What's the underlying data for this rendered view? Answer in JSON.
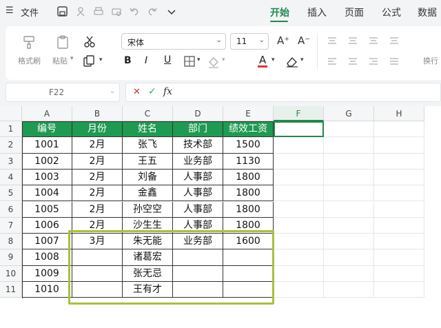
{
  "menu": {
    "hamburger_glyph": "☰",
    "file_label": "文件",
    "tabs": [
      "开始",
      "插入",
      "页面",
      "公式",
      "数据"
    ],
    "active_tab": "开始"
  },
  "ribbon": {
    "format_painter_label": "格式刷",
    "paste_label": "粘贴",
    "font_name": "宋体",
    "font_size": "11",
    "bold_glyph": "B",
    "italic_glyph": "I",
    "underline_glyph": "U",
    "font_color_glyph": "A",
    "increase_font_glyph": "A⁺",
    "decrease_font_glyph": "A⁻",
    "wrap_label": "换行",
    "accent_color": "#1e8a4a",
    "font_color": "#e0322f"
  },
  "formula_bar": {
    "cell_ref": "F22",
    "cancel_glyph": "✕",
    "confirm_glyph": "✓",
    "fx_glyph": "fx"
  },
  "sheet": {
    "columns": [
      "A",
      "B",
      "C",
      "D",
      "E",
      "F",
      "G",
      "H"
    ],
    "rows": [
      "1",
      "2",
      "3",
      "4",
      "5",
      "6",
      "7",
      "8",
      "9",
      "10",
      "11"
    ],
    "header_row": [
      "编号",
      "月份",
      "姓名",
      "部门",
      "绩效工资"
    ],
    "data": [
      [
        "1001",
        "2月",
        "张飞",
        "技术部",
        "1500"
      ],
      [
        "1002",
        "2月",
        "王五",
        "业务部",
        "1130"
      ],
      [
        "1003",
        "2月",
        "刘备",
        "人事部",
        "1800"
      ],
      [
        "1004",
        "2月",
        "金鑫",
        "人事部",
        "1800"
      ],
      [
        "1005",
        "2月",
        "孙空空",
        "人事部",
        "1800"
      ],
      [
        "1006",
        "2月",
        "沙生生",
        "人事部",
        "1800"
      ],
      [
        "1007",
        "3月",
        "朱无能",
        "业务部",
        "1600"
      ],
      [
        "1008",
        "",
        "诸葛宏",
        "",
        ""
      ],
      [
        "1009",
        "",
        "张无忌",
        "",
        ""
      ],
      [
        "1010",
        "",
        "王有才",
        "",
        ""
      ]
    ],
    "header_color": "#1f9a52",
    "highlight_color": "#a6c23a"
  }
}
